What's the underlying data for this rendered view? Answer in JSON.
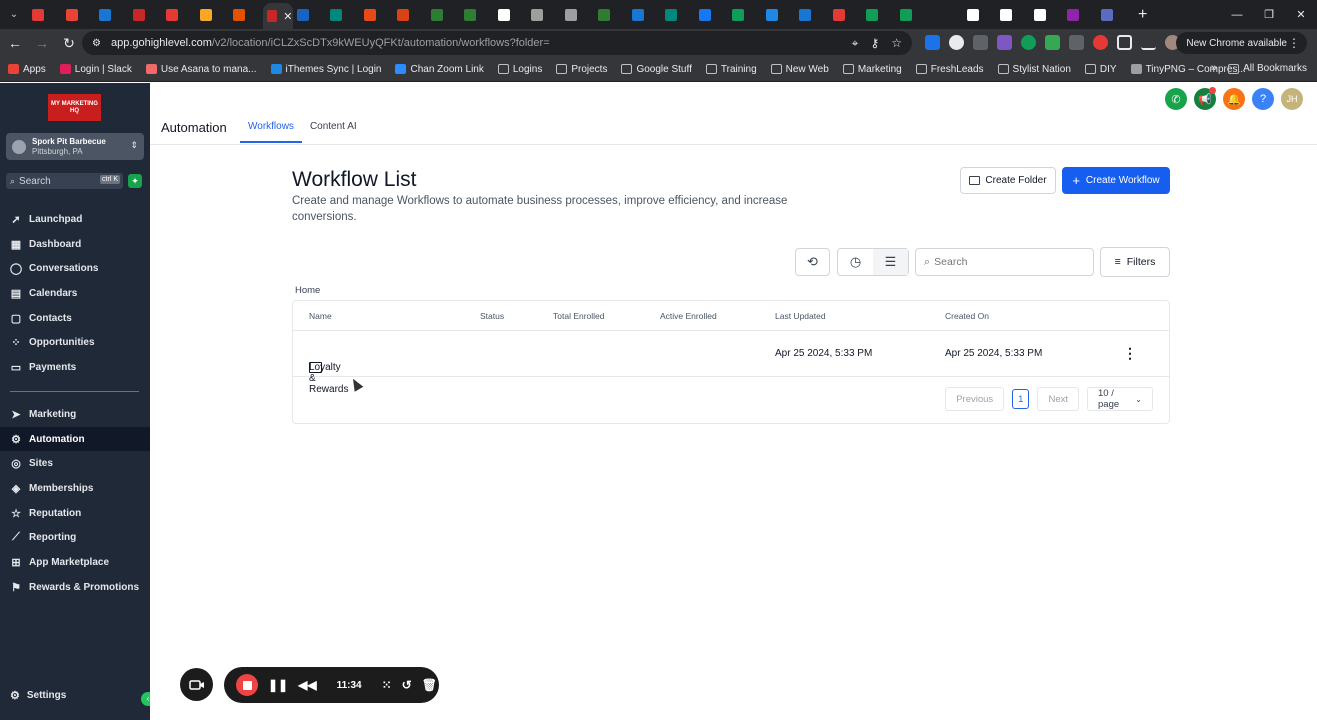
{
  "browser": {
    "address": {
      "host": "app.gohighlevel.com",
      "path": "/v2/location/iCLZxScDTx9kWEUyQFKt/automation/workflows?folder="
    },
    "update_label": "New Chrome available",
    "tab_colors": [
      "#e53935",
      "#ea4335",
      "#1976d2",
      "#c62828",
      "#e53935",
      "#f9a825",
      "#e65100",
      "#c62828",
      "#1565c0",
      "#00897b",
      "#e64a19",
      "#d84315",
      "#2e7d32",
      "#2e7d32",
      "#ffffff",
      "#9e9e9e",
      "#9e9e9e",
      "#2e7d32",
      "#1976d2",
      "#00897b",
      "#1877f2",
      "#0f9d58",
      "#1e88e5",
      "#1976d2",
      "#e53935",
      "#0f9d58",
      "#0f9d58",
      "#202124",
      "#ffffff",
      "#ffffff",
      "#ffffff",
      "#8e24aa",
      "#5c6bc0"
    ]
  },
  "bookmarks": {
    "items": [
      {
        "label": "Apps",
        "icon": "apps-grid-icon",
        "color": "#ea4335"
      },
      {
        "label": "Login | Slack",
        "icon": "slack-icon",
        "color": "#e01e5a"
      },
      {
        "label": "Use Asana to mana...",
        "icon": "asana-icon",
        "color": "#f06a6a"
      },
      {
        "label": "iThemes Sync | Login",
        "icon": "ithemes-icon",
        "color": "#1e88e5"
      },
      {
        "label": "Chan Zoom Link",
        "icon": "zoom-icon",
        "color": "#2d8cff"
      },
      {
        "label": "Logins",
        "icon": "folder-icon"
      },
      {
        "label": "Projects",
        "icon": "folder-icon"
      },
      {
        "label": "Google Stuff",
        "icon": "folder-icon"
      },
      {
        "label": "Training",
        "icon": "folder-icon"
      },
      {
        "label": "New Web",
        "icon": "folder-icon"
      },
      {
        "label": "Marketing",
        "icon": "folder-icon"
      },
      {
        "label": "FreshLeads",
        "icon": "folder-icon"
      },
      {
        "label": "Stylist Nation",
        "icon": "folder-icon"
      },
      {
        "label": "DIY",
        "icon": "folder-icon"
      },
      {
        "label": "TinyPNG – Compres...",
        "icon": "tinypng-icon",
        "color": "#9e9e9e"
      }
    ],
    "all_label": "All Bookmarks"
  },
  "sidebar": {
    "logo_text": "MY MARKETING HQ",
    "account": {
      "name": "Spork Pit Barbecue",
      "location": "Pittsburgh, PA"
    },
    "search": {
      "placeholder": "Search",
      "shortcut": "ctrl K"
    },
    "items_top": [
      {
        "label": "Launchpad",
        "icon": "rocket-icon",
        "glyph": "➚"
      },
      {
        "label": "Dashboard",
        "icon": "dashboard-icon",
        "glyph": "▦"
      },
      {
        "label": "Conversations",
        "icon": "chat-icon",
        "glyph": "◯"
      },
      {
        "label": "Calendars",
        "icon": "calendar-icon",
        "glyph": "▤"
      },
      {
        "label": "Contacts",
        "icon": "contacts-icon",
        "glyph": "▢"
      },
      {
        "label": "Opportunities",
        "icon": "opportunities-icon",
        "glyph": "⁘"
      },
      {
        "label": "Payments",
        "icon": "payments-icon",
        "glyph": "▭"
      }
    ],
    "items_bottom": [
      {
        "label": "Marketing",
        "icon": "send-icon",
        "glyph": "➤"
      },
      {
        "label": "Automation",
        "icon": "automation-icon",
        "glyph": "⚙",
        "active": true
      },
      {
        "label": "Sites",
        "icon": "globe-icon",
        "glyph": "◎"
      },
      {
        "label": "Memberships",
        "icon": "memberships-icon",
        "glyph": "◈"
      },
      {
        "label": "Reputation",
        "icon": "star-icon",
        "glyph": "☆"
      },
      {
        "label": "Reporting",
        "icon": "reporting-icon",
        "glyph": "⟋"
      },
      {
        "label": "App Marketplace",
        "icon": "marketplace-icon",
        "glyph": "⊞"
      },
      {
        "label": "Rewards & Promotions",
        "icon": "gift-icon",
        "glyph": "⚑"
      }
    ],
    "settings_label": "Settings"
  },
  "header": {
    "title": "Automation",
    "tabs": [
      {
        "label": "Workflows",
        "active": true
      },
      {
        "label": "Content AI"
      }
    ],
    "avatar_initials": "JH",
    "help_glyph": "?"
  },
  "main": {
    "title": "Workflow List",
    "subtitle": "Create and manage Workflows to automate business processes, improve efficiency, and increase conversions.",
    "create_folder_label": "Create Folder",
    "create_workflow_label": "Create Workflow",
    "search_placeholder": "Search",
    "filters_label": "Filters",
    "breadcrumb": "Home",
    "columns": [
      "Name",
      "Status",
      "Total Enrolled",
      "Active Enrolled",
      "Last Updated",
      "Created On"
    ],
    "rows": [
      {
        "name": "Loyalty & Rewards",
        "status": "",
        "total_enrolled": "",
        "active_enrolled": "",
        "last_updated": "Apr 25 2024, 5:33 PM",
        "created_on": "Apr 25 2024, 5:33 PM"
      }
    ],
    "pager": {
      "previous": "Previous",
      "current_page": "1",
      "next": "Next",
      "per_page": "10 / page"
    }
  },
  "recorder": {
    "time": "11:34"
  },
  "colors": {
    "brand_blue": "#155eef",
    "sidebar_bg": "#1f2937",
    "logo_red": "#c81e1e",
    "accent_green": "#22c55e"
  }
}
